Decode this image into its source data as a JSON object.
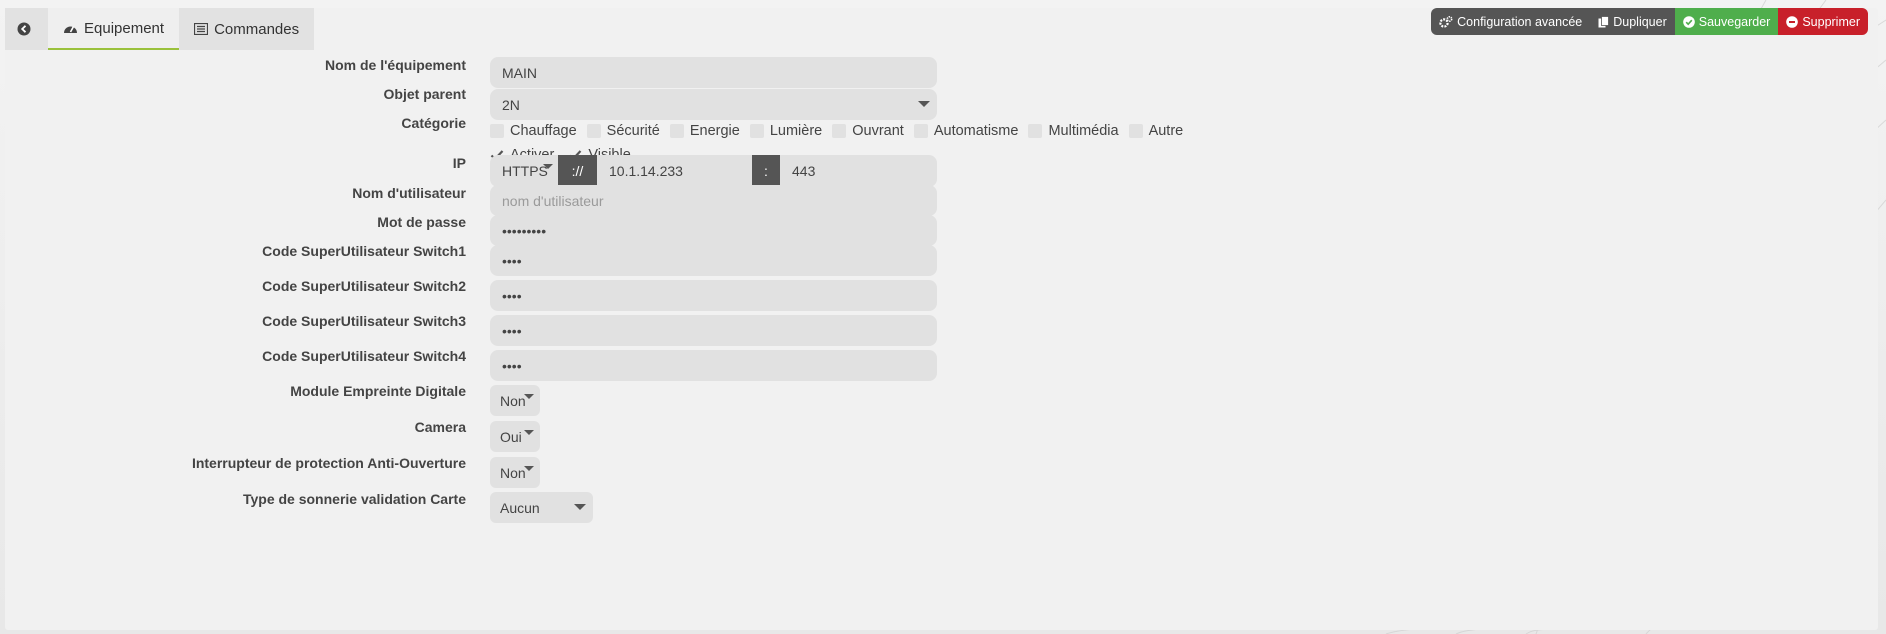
{
  "tabs": {
    "back_icon": "arrow-circle-left-icon",
    "equipement": "Equipement",
    "commandes": "Commandes"
  },
  "actions": {
    "config": "Configuration avancée",
    "dupliquer": "Dupliquer",
    "sauvegarder": "Sauvegarder",
    "supprimer": "Supprimer"
  },
  "colors": {
    "accent": "#9ac13b",
    "save": "#4fae4c",
    "delete": "#c8202a",
    "dark": "#555555"
  },
  "form": {
    "nom": {
      "label": "Nom de l'équipement",
      "value": "MAIN"
    },
    "parent": {
      "label": "Objet parent",
      "value": "2N"
    },
    "categorie": {
      "label": "Catégorie",
      "items": [
        "Chauffage",
        "Sécurité",
        "Energie",
        "Lumière",
        "Ouvrant",
        "Automatisme",
        "Multimédia",
        "Autre"
      ]
    },
    "activer": "Activer",
    "visible": "Visible",
    "ip": {
      "label": "IP",
      "protocol": "HTTPS",
      "sep1": "://",
      "address": "10.1.14.233",
      "sep2": ":",
      "port": "443"
    },
    "user": {
      "label": "Nom d'utilisateur",
      "placeholder": "nom d'utilisateur"
    },
    "password": {
      "label": "Mot de passe",
      "value": "•••••••••"
    },
    "switch1": {
      "label": "Code SuperUtilisateur Switch1",
      "value": "••••"
    },
    "switch2": {
      "label": "Code SuperUtilisateur Switch2",
      "value": "••••"
    },
    "switch3": {
      "label": "Code SuperUtilisateur Switch3",
      "value": "••••"
    },
    "switch4": {
      "label": "Code SuperUtilisateur Switch4",
      "value": "••••"
    },
    "empreinte": {
      "label": "Module Empreinte Digitale",
      "value": "Non"
    },
    "camera": {
      "label": "Camera",
      "value": "Oui"
    },
    "antiouverture": {
      "label": "Interrupteur de protection Anti-Ouverture",
      "value": "Non"
    },
    "sonnerie": {
      "label": "Type de sonnerie validation Carte",
      "value": "Aucun"
    }
  }
}
